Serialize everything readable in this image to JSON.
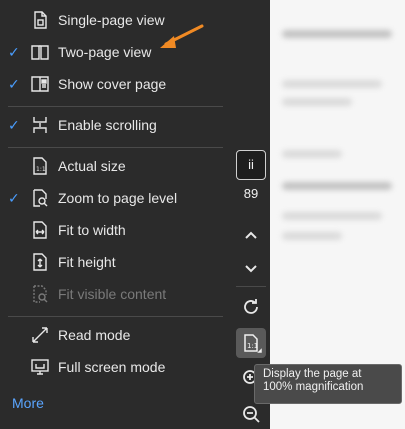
{
  "menu": {
    "items": [
      {
        "label": "Single-page view",
        "checked": false,
        "icon": "single-page-icon",
        "disabled": false
      },
      {
        "label": "Two-page view",
        "checked": true,
        "icon": "two-page-icon",
        "disabled": false
      },
      {
        "label": "Show cover page",
        "checked": true,
        "icon": "cover-page-icon",
        "disabled": false
      },
      {
        "label": "Enable scrolling",
        "checked": true,
        "icon": "scroll-icon",
        "disabled": false
      },
      {
        "label": "Actual size",
        "checked": false,
        "icon": "actual-size-icon",
        "disabled": false
      },
      {
        "label": "Zoom to page level",
        "checked": true,
        "icon": "zoom-page-icon",
        "disabled": false
      },
      {
        "label": "Fit to width",
        "checked": false,
        "icon": "fit-width-icon",
        "disabled": false
      },
      {
        "label": "Fit height",
        "checked": false,
        "icon": "fit-height-icon",
        "disabled": false
      },
      {
        "label": "Fit visible content",
        "checked": false,
        "icon": "fit-visible-icon",
        "disabled": true
      },
      {
        "label": "Read mode",
        "checked": false,
        "icon": "read-mode-icon",
        "disabled": false
      },
      {
        "label": "Full screen mode",
        "checked": false,
        "icon": "full-screen-icon",
        "disabled": false
      }
    ],
    "more_label": "More",
    "check_mark": "✓"
  },
  "rail": {
    "current_page": "ii",
    "total_pages": "89"
  },
  "tooltip": {
    "text": "Display the page at 100% magnification"
  },
  "colors": {
    "accent_blue": "#4a9eff",
    "annotation_arrow": "#f08a24",
    "menu_bg": "#2b2b2b"
  }
}
